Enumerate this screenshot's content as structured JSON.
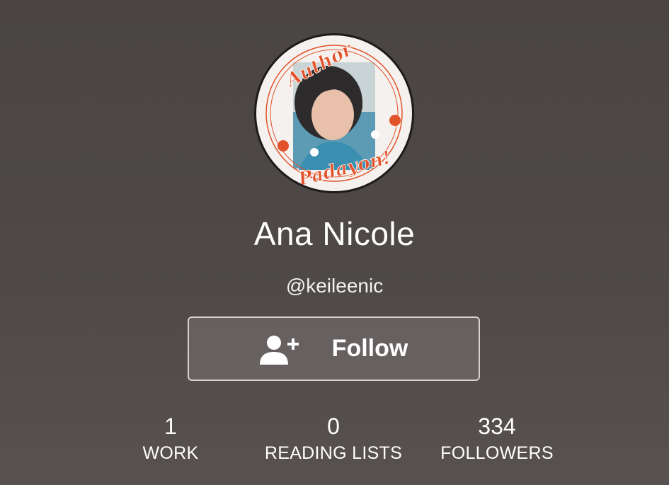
{
  "profile": {
    "avatar_badge_top": "Author",
    "avatar_badge_bottom": "Padayon!",
    "name": "Ana Nicole",
    "handle": "@keileenic"
  },
  "actions": {
    "follow_label": "Follow",
    "follow_icon": "add-user-icon"
  },
  "stats": [
    {
      "value": "1",
      "label": "WORK"
    },
    {
      "value": "0",
      "label": "READING LISTS"
    },
    {
      "value": "334",
      "label": "FOLLOWERS"
    }
  ],
  "colors": {
    "background": "#4d4846",
    "badge_orange": "#e2522a",
    "text": "#ffffff"
  }
}
